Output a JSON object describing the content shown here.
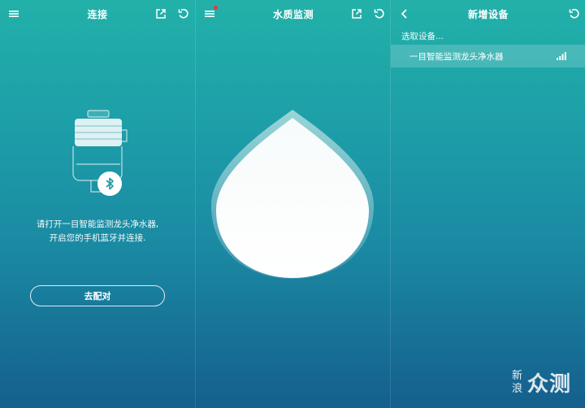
{
  "screen_connect": {
    "title": "连接",
    "instruction_line1": "请打开一目智能监测龙头净水器,",
    "instruction_line2": "开启您的手机蓝牙并连接.",
    "pair_button": "去配对",
    "icons": [
      "menu-icon",
      "share-icon",
      "refresh-icon",
      "bluetooth-icon"
    ]
  },
  "screen_water": {
    "title": "水质监测",
    "icons": [
      "menu-icon",
      "notification-dot",
      "share-icon",
      "refresh-icon",
      "water-drop"
    ],
    "notification_color": "#f0333b"
  },
  "screen_add": {
    "title": "新增设备",
    "searching_text": "选取设备...",
    "device_name": "一目智能监测龙头净水器",
    "icons": [
      "back-icon",
      "refresh-icon",
      "signal-icon"
    ]
  },
  "watermark": {
    "small_top": "新",
    "small_bottom": "浪",
    "main": "众测"
  },
  "colors": {
    "gradient_top": "#22b1a9",
    "gradient_bottom": "#155f8d"
  }
}
